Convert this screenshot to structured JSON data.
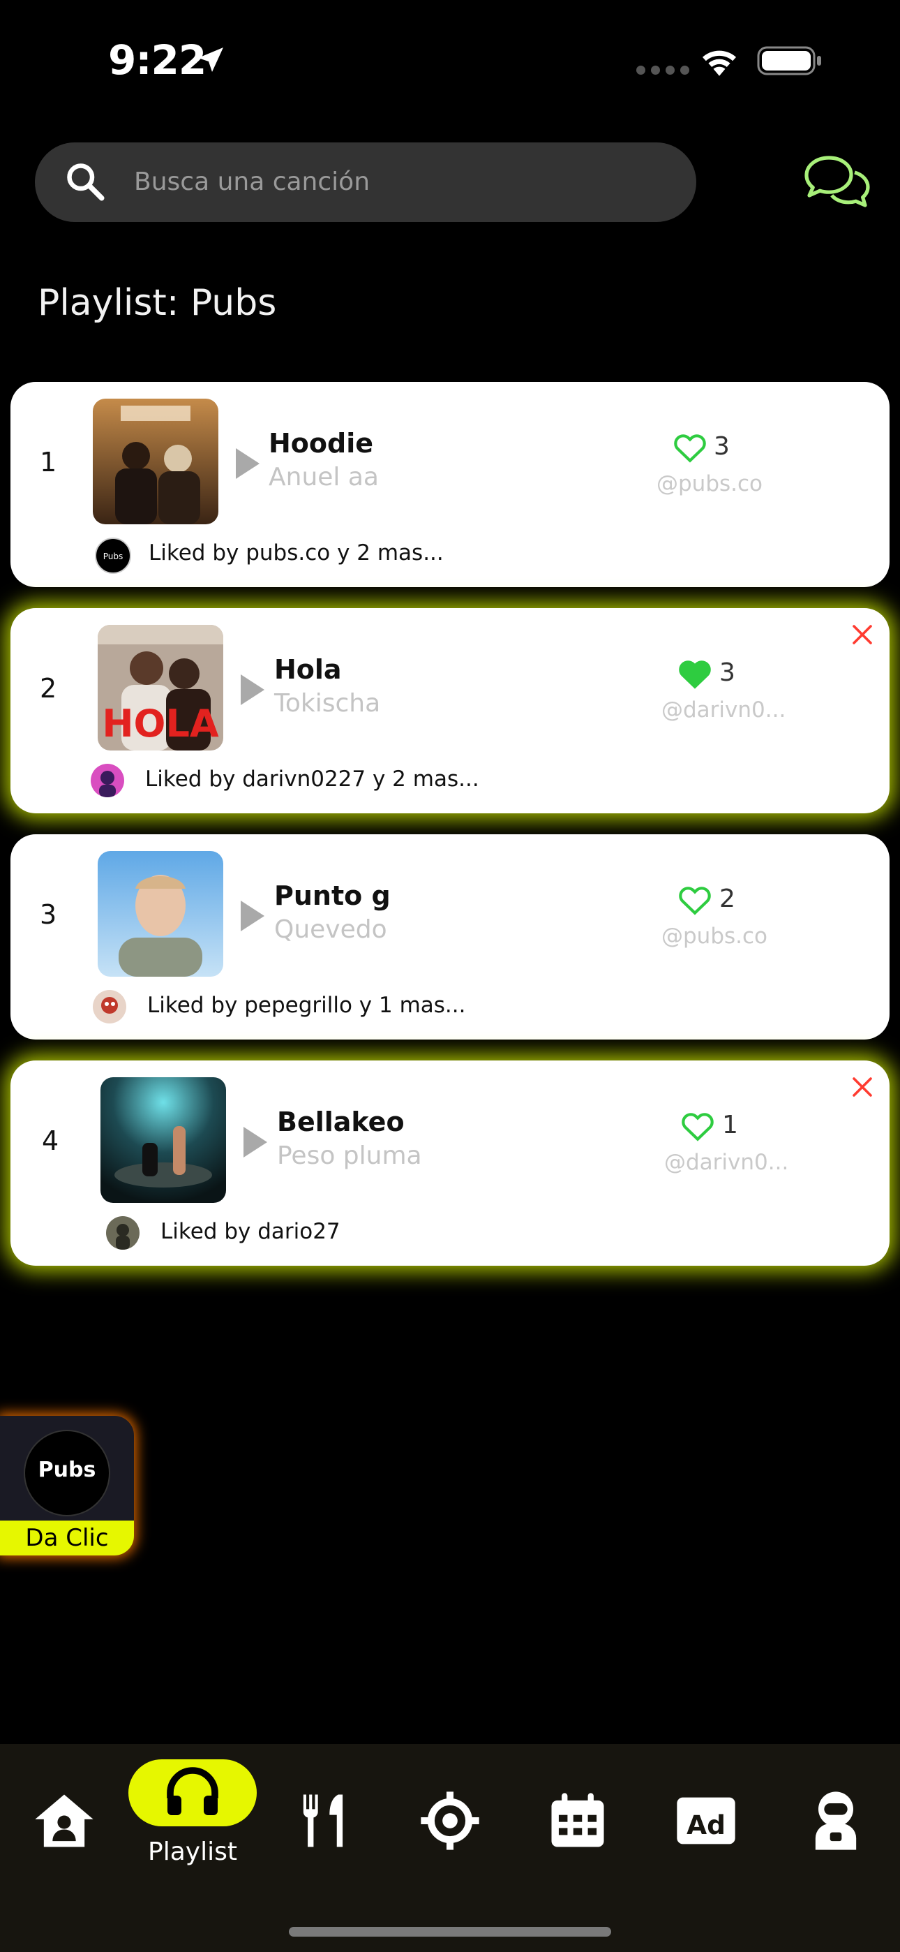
{
  "status_bar": {
    "time": "9:22"
  },
  "search": {
    "placeholder": "Busca una canción"
  },
  "page_title": "Playlist: Pubs",
  "tracks": [
    {
      "number": "1",
      "title": "Hoodie",
      "artist": "Anuel aa",
      "likes": "3",
      "liked": false,
      "added_by": "@pubs.co",
      "liked_by": "Liked by pubs.co y 2 mas...",
      "removable": false
    },
    {
      "number": "2",
      "title": "Hola",
      "artist": "Tokischa",
      "likes": "3",
      "liked": true,
      "added_by": "@darivn0...",
      "liked_by": "Liked by darivn0227 y 2 mas...",
      "removable": true
    },
    {
      "number": "3",
      "title": "Punto g",
      "artist": "Quevedo",
      "likes": "2",
      "liked": false,
      "added_by": "@pubs.co",
      "liked_by": "Liked by pepegrillo y 1 mas...",
      "removable": false
    },
    {
      "number": "4",
      "title": "Bellakeo",
      "artist": "Peso pluma",
      "likes": "1",
      "liked": false,
      "added_by": "@darivn0...",
      "liked_by": "Liked by dario27",
      "removable": true
    }
  ],
  "fab": {
    "logo_text": "Pubs",
    "label": "Da Clic"
  },
  "tabbar": {
    "active": "Playlist",
    "items": [
      "home-icon",
      "headphones-icon",
      "restaurant-icon",
      "location-icon",
      "calendar-icon",
      "ad-icon",
      "astronaut-icon"
    ]
  },
  "colors": {
    "accent": "#E6F700",
    "heart": "#2ECC40",
    "close": "#FF3B30",
    "chat_icon": "#A8F07A"
  }
}
